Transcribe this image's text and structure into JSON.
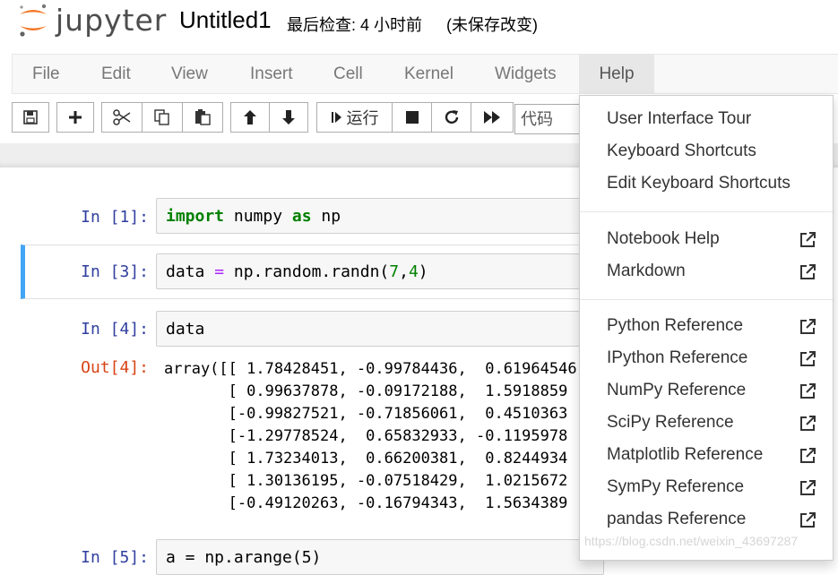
{
  "header": {
    "logo_text": "jupyter",
    "notebook_name": "Untitled1",
    "checkpoint": "最后检查: 4 小时前",
    "unsaved": "(未保存改变)"
  },
  "menubar": [
    "File",
    "Edit",
    "View",
    "Insert",
    "Cell",
    "Kernel",
    "Widgets",
    "Help"
  ],
  "toolbar": {
    "run_label": "运行",
    "cell_type": "代码",
    "icons": [
      "save-icon",
      "plus-icon",
      "scissors-icon",
      "copy-icon",
      "paste-icon",
      "arrow-up-icon",
      "arrow-down-icon",
      "step-icon",
      "stop-icon",
      "restart-icon",
      "fast-forward-icon"
    ]
  },
  "cells": [
    {
      "prompt": "In  [1]:",
      "code": {
        "kw1": "import",
        "mid": " numpy ",
        "kw2": "as",
        "tail": " np"
      }
    },
    {
      "prompt": "In  [3]:",
      "code": {
        "a": "data ",
        "eq": "=",
        "b": " np.random.randn(",
        "n1": "7",
        "c": ",",
        "n2": "4",
        "d": ")"
      }
    },
    {
      "prompt": "In  [4]:",
      "code": "data"
    },
    {
      "prompt": "In  [5]:",
      "code": "a = np.arange(5)"
    }
  ],
  "output": {
    "prompt": "Out[4]:",
    "lines": [
      "array([[ 1.78428451, -0.99784436,  0.61964546",
      "       [ 0.99637878, -0.09172188,  1.5918859",
      "       [-0.99827521, -0.71856061,  0.4510363",
      "       [-1.29778524,  0.65832933, -0.1195978",
      "       [ 1.73234013,  0.66200381,  0.8244934",
      "       [ 1.30136195, -0.07518429,  1.0215672",
      "       [-0.49120263, -0.16794343,  1.5634389"
    ]
  },
  "help_menu": {
    "group1": [
      "User Interface Tour",
      "Keyboard Shortcuts",
      "Edit Keyboard Shortcuts"
    ],
    "group2": [
      "Notebook Help",
      "Markdown"
    ],
    "group3": [
      "Python Reference",
      "IPython Reference",
      "NumPy Reference",
      "SciPy Reference",
      "Matplotlib Reference",
      "SymPy Reference",
      "pandas Reference"
    ]
  },
  "watermark": "https://blog.csdn.net/weixin_43697287",
  "colors": {
    "logo_orange": "#f37726",
    "selected_bar": "#42a5f5",
    "keyword": "#008000",
    "operator": "#aa22ff",
    "in_prompt": "#303f9f",
    "out_prompt": "#d84315"
  }
}
